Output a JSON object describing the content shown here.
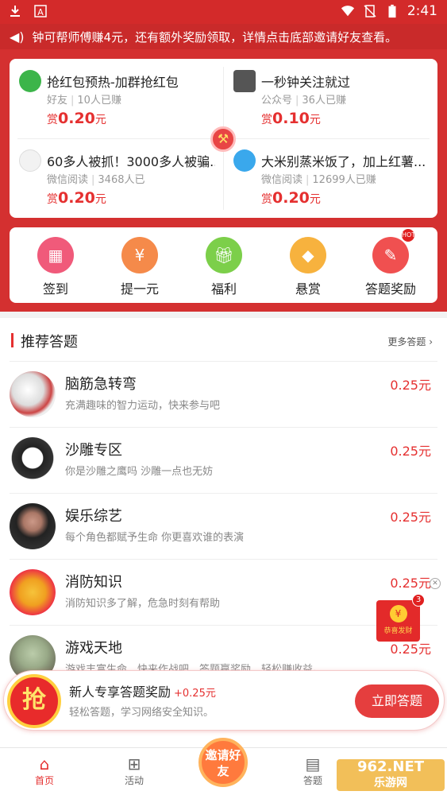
{
  "status": {
    "time": "2:41",
    "left_icons": [
      "download-icon",
      "a-icon"
    ],
    "right_icons": [
      "wifi-icon",
      "no-sim-icon",
      "battery-icon"
    ]
  },
  "ticker": {
    "text": "钟可帮师傅赚4元，还有额外奖励领取，详情点击底部邀请好友查看。"
  },
  "tasks": [
    {
      "title": "抢红包预热-加群抢红包",
      "source": "好友",
      "count": "10人已赚",
      "reward_prefix": "赏",
      "reward": "0.20",
      "unit": "元",
      "icon": "wechat-icon"
    },
    {
      "title": "一秒钟关注就过",
      "source": "公众号",
      "count": "36人已赚",
      "reward_prefix": "赏",
      "reward": "0.10",
      "unit": "元",
      "icon": "qr-icon"
    },
    {
      "title": "60多人被抓！3000多人被骗...",
      "source": "微信阅读",
      "count": "3468人已",
      "reward_prefix": "赏",
      "reward": "0.20",
      "unit": "元",
      "icon": "article-icon"
    },
    {
      "title": "大米别蒸米饭了，加上红薯...",
      "source": "微信阅读",
      "count": "12699人已赚",
      "reward_prefix": "赏",
      "reward": "0.20",
      "unit": "元",
      "icon": "avatar-icon"
    }
  ],
  "menu": [
    {
      "label": "签到",
      "icon": "calendar-icon",
      "color": "#f05a7a"
    },
    {
      "label": "提一元",
      "icon": "money-icon",
      "color": "#f58a4a"
    },
    {
      "label": "福利",
      "icon": "gift-icon",
      "color": "#7ccf4a"
    },
    {
      "label": "悬赏",
      "icon": "diamond-icon",
      "color": "#f7b23e"
    },
    {
      "label": "答题奖励",
      "icon": "quiz-icon",
      "color": "#f05050",
      "badge": "HOT"
    }
  ],
  "recommend": {
    "title": "推荐答题",
    "more": "更多答题",
    "items": [
      {
        "title": "脑筋急转弯",
        "desc": "充满趣味的智力运动，快来参与吧",
        "price": "0.25元"
      },
      {
        "title": "沙雕专区",
        "desc": "你是沙雕之鹰吗 沙雕一点也无妨",
        "price": "0.25元"
      },
      {
        "title": "娱乐综艺",
        "desc": "每个角色都赋予生命 你更喜欢谁的表演",
        "price": "0.25元"
      },
      {
        "title": "消防知识",
        "desc": "消防知识多了解，危急时刻有帮助",
        "price": "0.25元"
      },
      {
        "title": "游戏天地",
        "desc": "游戏丰富生命，快来作战吧，答题赢奖励，轻松赚收益。",
        "price": "0.25元"
      }
    ]
  },
  "redpacket": {
    "count": "3",
    "label": "恭喜发财"
  },
  "banner": {
    "grab": "抢",
    "title": "新人专享答题奖励",
    "bonus": "+0.25元",
    "subtitle": "轻松答题，学习网络安全知识。",
    "button": "立即答题"
  },
  "tabs": [
    {
      "label": "首页",
      "icon": "home-icon",
      "active": true
    },
    {
      "label": "活动",
      "icon": "gift-icon",
      "active": false
    },
    {
      "label": "答题",
      "icon": "document-icon",
      "active": false
    }
  ],
  "invite": {
    "label": "邀请好友"
  },
  "watermark": {
    "top": "962.NET",
    "bottom": "乐游网"
  },
  "colors": {
    "brand_red": "#d43030",
    "price_red": "#e53030"
  }
}
